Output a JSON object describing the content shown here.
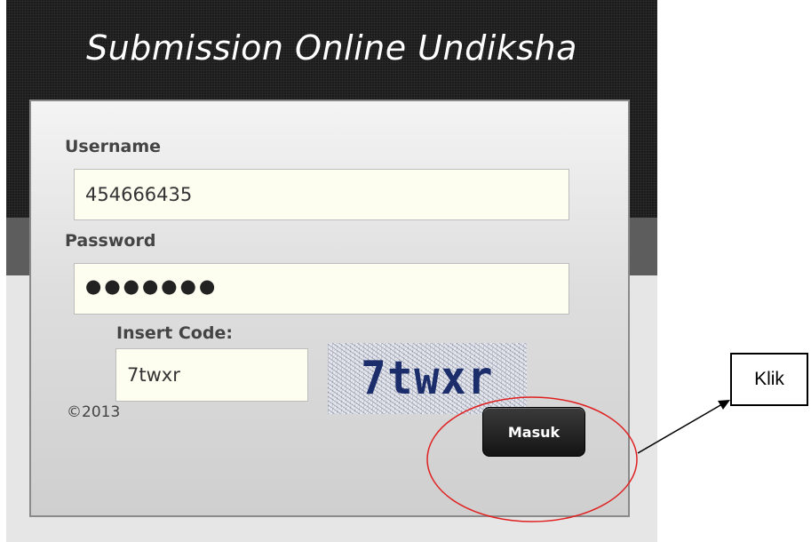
{
  "header": {
    "title": "Submission Online Undiksha"
  },
  "login": {
    "username_label": "Username",
    "username_value": "454666435",
    "password_label": "Password",
    "password_masked": "●●●●●●●",
    "code_label": "Insert Code:",
    "code_value": "7twxr",
    "captcha_text": "7twxr",
    "copyright": "©2013",
    "submit_label": "Masuk"
  },
  "annotation": {
    "callout_text": "Klik",
    "highlight_color": "#e02020"
  }
}
